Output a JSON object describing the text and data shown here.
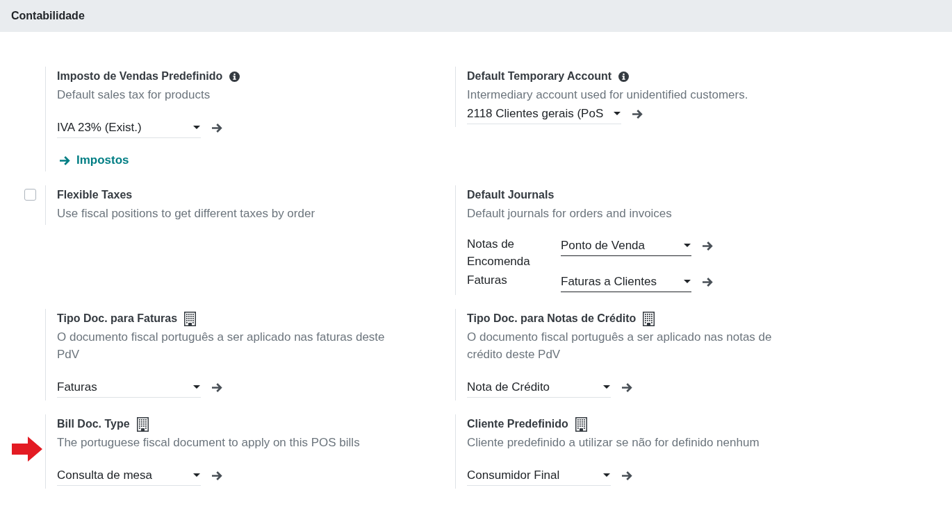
{
  "section": {
    "title": "Contabilidade"
  },
  "settings": [
    {
      "kind": "select",
      "title": "Imposto de Vendas Predefinido",
      "has_help": true,
      "company_dependent": false,
      "marked": false,
      "description": "Default sales tax for products",
      "field": {
        "value": "IVA 23% (Exist.)",
        "required": false
      },
      "link": "Impostos"
    },
    {
      "kind": "inline_select",
      "title": "Default Temporary Account",
      "has_help": true,
      "company_dependent": false,
      "marked": false,
      "description": "Intermediary account used for unidentified customers.",
      "field": {
        "value": "2118 Clientes gerais (PoS",
        "required": false
      }
    },
    {
      "kind": "checkbox",
      "title": "Flexible Taxes",
      "has_help": false,
      "company_dependent": false,
      "marked": false,
      "checked": false,
      "description": "Use fiscal positions to get different taxes by order"
    },
    {
      "kind": "journals",
      "title": "Default Journals",
      "has_help": false,
      "company_dependent": false,
      "marked": false,
      "description": "Default journals for orders and invoices",
      "journals": [
        {
          "label": "Notas de Encomenda",
          "value": "Ponto de Venda",
          "required": true
        },
        {
          "label": "Faturas",
          "value": "Faturas a Clientes",
          "required": true
        }
      ]
    },
    {
      "kind": "select",
      "title": "Tipo Doc. para Faturas",
      "has_help": false,
      "company_dependent": true,
      "marked": false,
      "description": "O documento fiscal português a ser aplicado nas faturas deste PdV",
      "field": {
        "value": "Faturas",
        "required": false
      }
    },
    {
      "kind": "select",
      "title": "Tipo Doc. para Notas de Crédito",
      "has_help": false,
      "company_dependent": true,
      "marked": false,
      "description": "O documento fiscal português a ser aplicado nas notas de crédito deste PdV",
      "field": {
        "value": "Nota de Crédito",
        "required": false
      }
    },
    {
      "kind": "select",
      "title": "Bill Doc. Type",
      "has_help": false,
      "company_dependent": true,
      "marked": true,
      "description": "The portuguese fiscal document to apply on this POS bills",
      "field": {
        "value": "Consulta de mesa",
        "required": false
      }
    },
    {
      "kind": "select",
      "title": "Cliente Predefinido",
      "has_help": false,
      "company_dependent": true,
      "marked": false,
      "description": "Cliente predefinido a utilizar se não for definido nenhum",
      "field": {
        "value": "Consumidor Final",
        "required": false
      }
    }
  ]
}
